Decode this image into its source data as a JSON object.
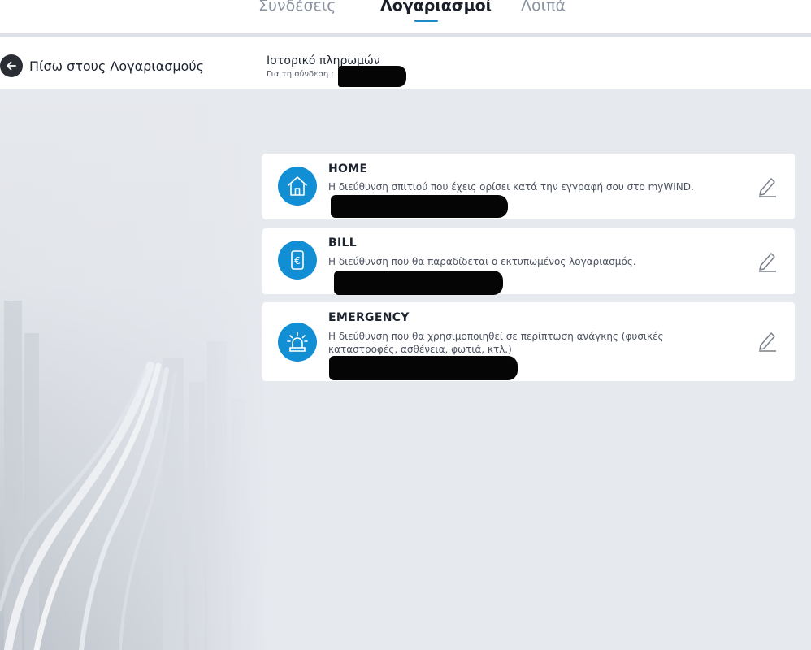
{
  "tabs": [
    {
      "label": "Συνδέσεις",
      "active": false
    },
    {
      "label": "Λογαριασμοί",
      "active": true
    },
    {
      "label": "Λοιπά",
      "active": false
    }
  ],
  "header": {
    "back_label": "Πίσω στους Λογαριασμούς",
    "history_title": "Ιστορικό πληρωμών",
    "history_subtitle": "Για τη σύνδεση :"
  },
  "cards": [
    {
      "icon": "house-icon",
      "title": "HOME",
      "description": "Η διεύθυνση σπιτιού που έχεις ορίσει κατά την εγγραφή σου στο myWIND."
    },
    {
      "icon": "euro-bill-icon",
      "title": "BILL",
      "description": "Η διεύθυνση που θα παραδίδεται ο εκτυπωμένος λογαριασμός."
    },
    {
      "icon": "siren-icon",
      "title": "EMERGENCY",
      "description": "Η διεύθυνση που θα χρησιμοποιηθεί σε περίπτωση ανάγκης (φυσικές καταστροφές, ασθένεια, φωτιά, κτλ.)"
    }
  ],
  "colors": {
    "accent": "#128fd4",
    "page_bg": "#e6e9ee",
    "redaction": "#050505"
  }
}
